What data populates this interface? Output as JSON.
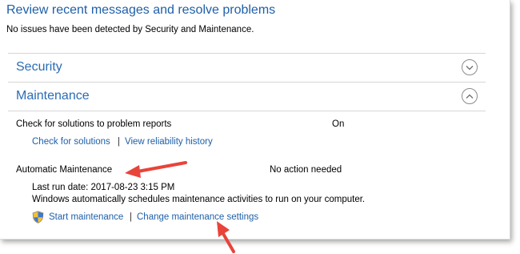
{
  "page": {
    "title": "Review recent messages and resolve problems",
    "subtitle": "No issues have been detected by Security and Maintenance."
  },
  "sections": {
    "security": {
      "label": "Security",
      "icon": "chevron-down-icon",
      "expanded": false
    },
    "maintenance": {
      "label": "Maintenance",
      "icon": "chevron-up-icon",
      "expanded": true
    }
  },
  "problem_reports": {
    "label": "Check for solutions to problem reports",
    "status": "On",
    "links": {
      "check": "Check for solutions",
      "separator": "|",
      "history": "View reliability history"
    }
  },
  "automatic_maintenance": {
    "label": "Automatic Maintenance",
    "status": "No action needed",
    "last_run": "Last run date: 2017-08-23 3:15 PM",
    "description": "Windows automatically schedules maintenance activities to run on your computer.",
    "links": {
      "start": "Start maintenance",
      "separator": "|",
      "change": "Change maintenance settings"
    },
    "start_icon": "uac-shield-icon"
  },
  "colors": {
    "link": "#1e5fa8",
    "heading": "#2a6cb5",
    "annotation_arrow": "#e8443a"
  }
}
